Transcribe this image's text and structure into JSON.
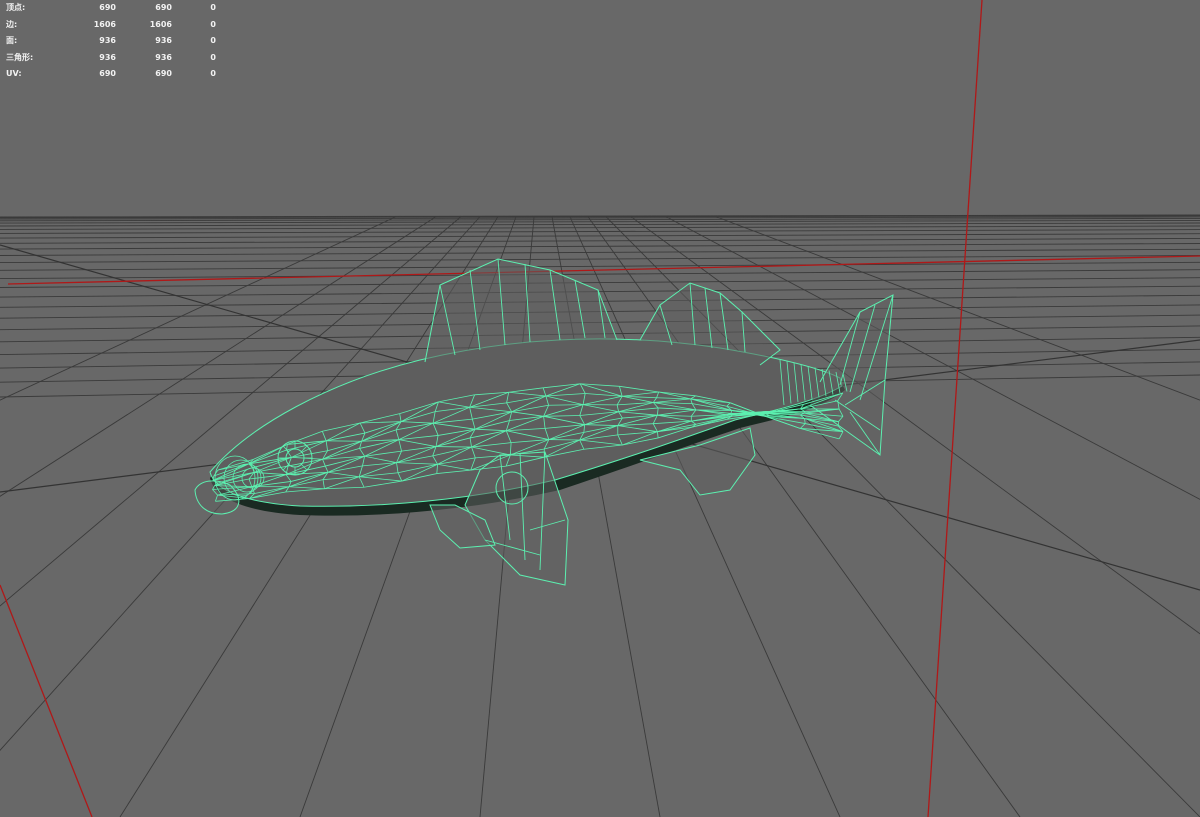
{
  "hud": {
    "rows": [
      {
        "label": "顶点:",
        "v1": "690",
        "v2": "690",
        "v3": "0"
      },
      {
        "label": "边:",
        "v1": "1606",
        "v2": "1606",
        "v3": "0"
      },
      {
        "label": "面:",
        "v1": "936",
        "v2": "936",
        "v3": "0"
      },
      {
        "label": "三角形:",
        "v1": "936",
        "v2": "936",
        "v3": "0"
      },
      {
        "label": "UV:",
        "v1": "690",
        "v2": "690",
        "v3": "0"
      }
    ]
  },
  "colors": {
    "background": "#686868",
    "grid": "#3a3a3a",
    "axis_red": "#b01818",
    "wireframe": "#5cf0b0",
    "fish_fill": "#5e5e5e"
  },
  "viewport": {
    "object": "fish-mesh",
    "display_mode": "wireframe-on-shaded"
  }
}
